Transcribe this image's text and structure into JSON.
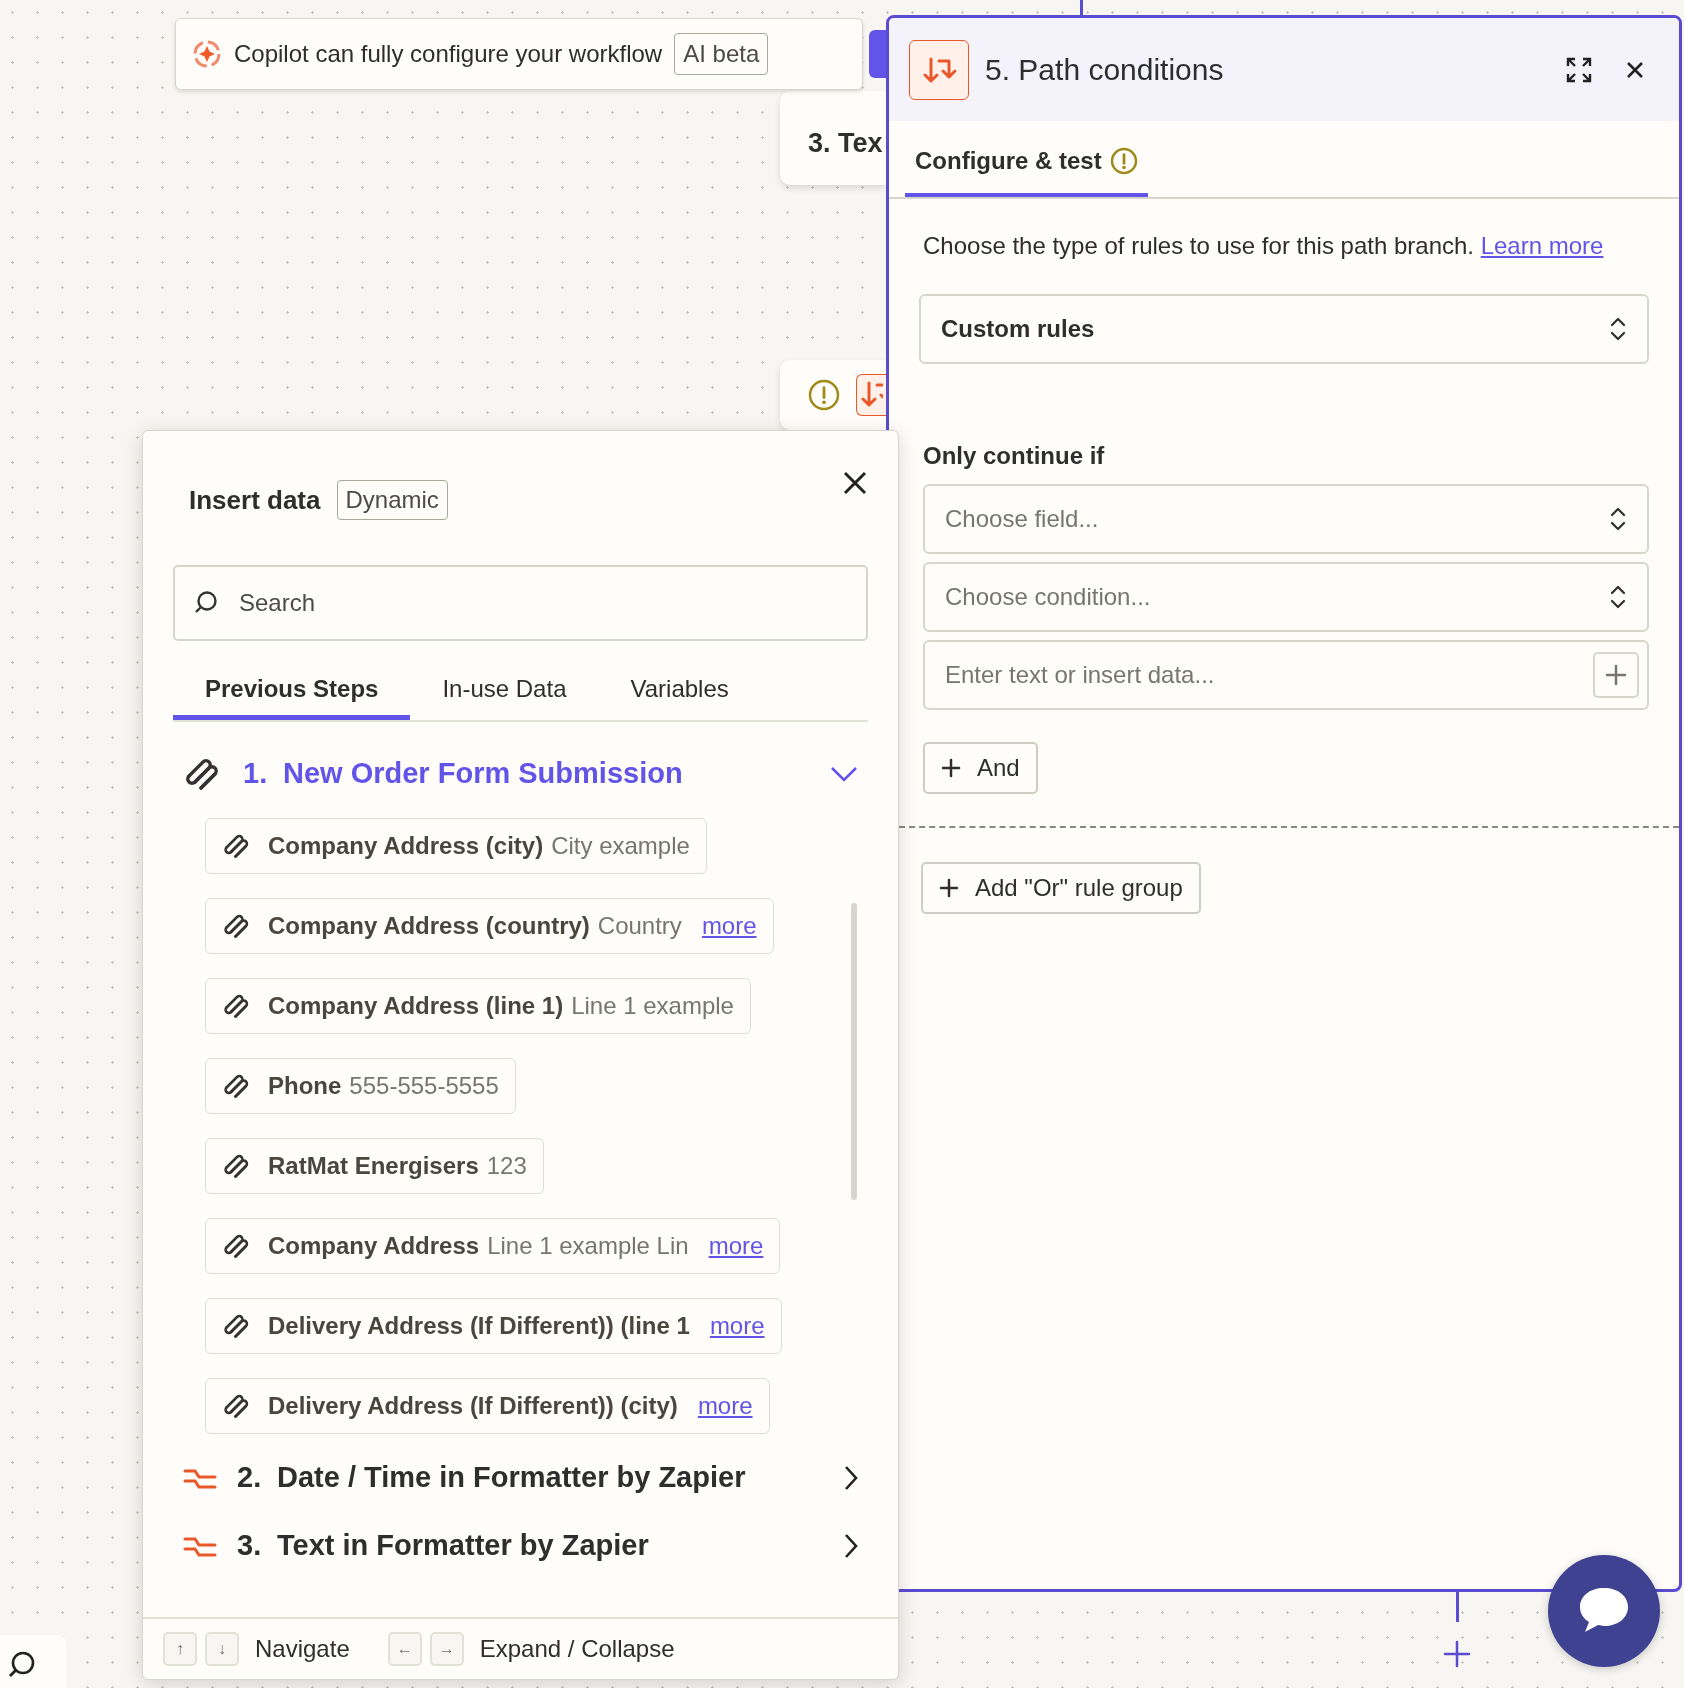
{
  "copilot_banner": {
    "text": "Copilot can fully configure your workflow",
    "badge": "AI beta"
  },
  "canvas_nodes": [
    {
      "title": "3. Tex",
      "warning": false
    },
    {
      "warning": true
    }
  ],
  "step_panel": {
    "title": "5. Path conditions",
    "tabs": [
      {
        "label": "Configure & test",
        "selected": true,
        "warning": true
      }
    ],
    "description": "Choose the type of rules to use for this path branch. ",
    "learn_more": "Learn more",
    "rule_type": "Custom rules",
    "section_label": "Only continue if",
    "fields": [
      {
        "kind": "select",
        "placeholder": "Choose field..."
      },
      {
        "kind": "select",
        "placeholder": "Choose condition..."
      },
      {
        "kind": "text",
        "placeholder": "Enter text or insert data..."
      }
    ],
    "and_button": "And",
    "or_button": "Add \"Or\" rule group"
  },
  "insert_data": {
    "title": "Insert data",
    "badge": "Dynamic",
    "search_placeholder": "Search",
    "tabs": [
      {
        "label": "Previous Steps",
        "selected": true
      },
      {
        "label": "In-use Data",
        "selected": false
      },
      {
        "label": "Variables",
        "selected": false
      }
    ],
    "steps": [
      {
        "number": "1.",
        "name": "New Order Form Submission",
        "kind": "form",
        "expanded": true,
        "fields": [
          {
            "label": "Company Address (city)",
            "value": "City example"
          },
          {
            "label": "Company Address (country)",
            "value": "Country",
            "more": "more"
          },
          {
            "label": "Company Address (line 1)",
            "value": "Line 1 example"
          },
          {
            "label": "Phone",
            "value": "555-555-5555"
          },
          {
            "label": "RatMat Energisers",
            "value": "123"
          },
          {
            "label": "Company Address",
            "value": "Line 1 example Lin",
            "more": "more"
          },
          {
            "label": "Delivery Address (If Different)) (line 1",
            "more": "more"
          },
          {
            "label": "Delivery Address (If Different)) (city)",
            "more": "more"
          }
        ]
      },
      {
        "number": "2.",
        "name": "Date / Time in Formatter by Zapier",
        "kind": "formatter",
        "expanded": false
      },
      {
        "number": "3.",
        "name": "Text in Formatter by Zapier",
        "kind": "formatter",
        "expanded": false
      }
    ],
    "footer": [
      {
        "keys": [
          "↑",
          "↓"
        ],
        "label": "Navigate"
      },
      {
        "keys": [
          "←",
          "→"
        ],
        "label": "Expand / Collapse"
      }
    ]
  }
}
